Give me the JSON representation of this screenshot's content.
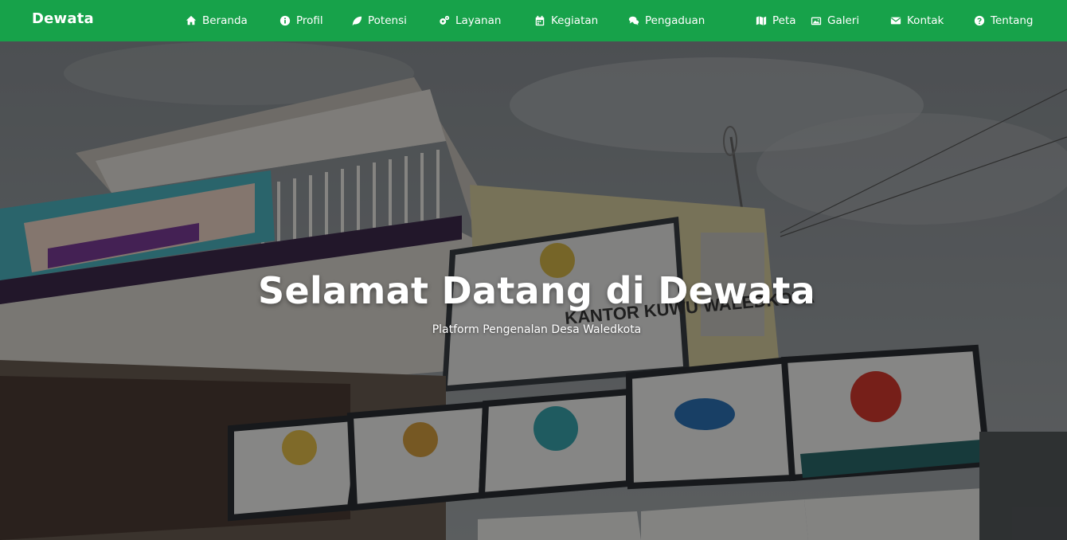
{
  "navbar": {
    "brand": "Dewata",
    "items": [
      {
        "label": "Beranda",
        "icon": "home-icon"
      },
      {
        "label": "Profil",
        "icon": "info-icon"
      },
      {
        "label": "Potensi",
        "icon": "leaf-icon"
      },
      {
        "label": "Layanan",
        "icon": "gears-icon"
      },
      {
        "label": "Kegiatan",
        "icon": "calendar-icon"
      },
      {
        "label": "Pengaduan",
        "icon": "comments-icon"
      },
      {
        "label": "Peta",
        "icon": "map-icon"
      },
      {
        "label": "Galeri",
        "icon": "images-icon"
      },
      {
        "label": "Kontak",
        "icon": "envelope-icon"
      },
      {
        "label": "Tentang",
        "icon": "question-icon"
      }
    ]
  },
  "hero": {
    "title": "Selamat Datang di Dewata",
    "subtitle": "Platform Pengenalan Desa Waledkota",
    "background_image": "village-office-building-photo"
  },
  "colors": {
    "navbar": "#17a24a",
    "text": "#ffffff",
    "overlay": "rgba(0,0,0,0.45)"
  }
}
